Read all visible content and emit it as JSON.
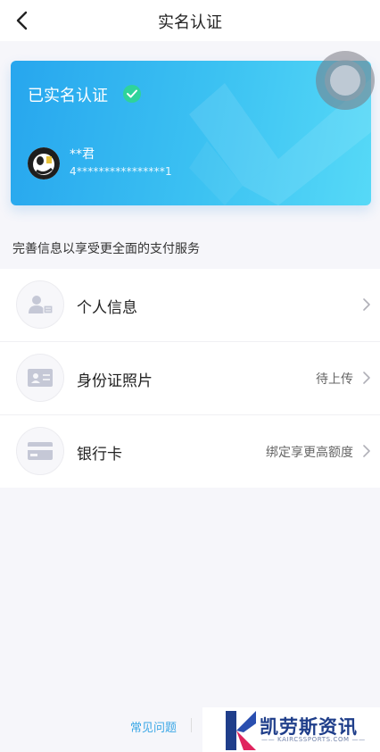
{
  "header": {
    "title": "实名认证"
  },
  "card": {
    "status_label": "已实名认证",
    "name": "**君",
    "id_masked": "4****************1"
  },
  "section_hint": "完善信息以享受更全面的支付服务",
  "list": [
    {
      "label": "个人信息",
      "status": ""
    },
    {
      "label": "身份证照片",
      "status": "待上传"
    },
    {
      "label": "银行卡",
      "status": "绑定享更高额度"
    }
  ],
  "footer": {
    "faq": "常见问题"
  },
  "watermark": {
    "name": "凯劳斯资讯",
    "site": "—— KAIRCSSPORTS.COM ——"
  },
  "colors": {
    "accent": "#3aa7e6",
    "card_start": "#27a6ee",
    "card_end": "#56d9f7",
    "verified": "#2fd39a"
  }
}
